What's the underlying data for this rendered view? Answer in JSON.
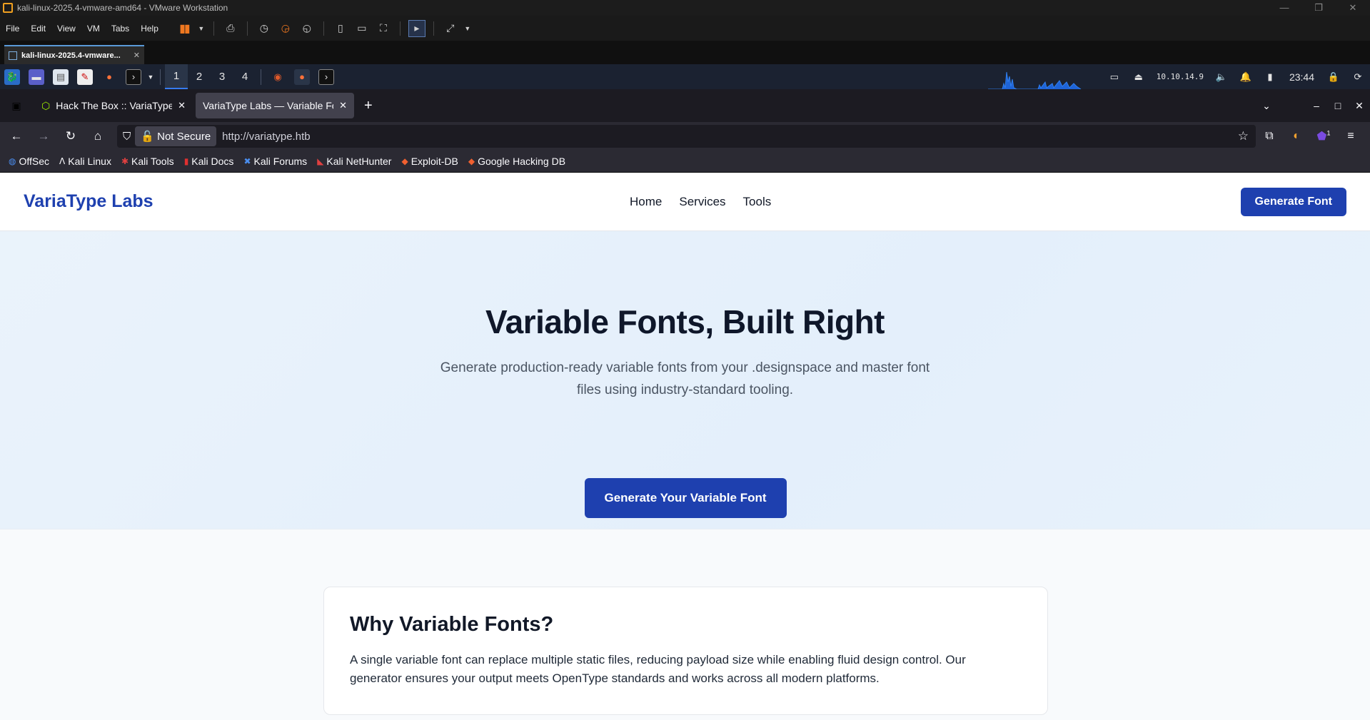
{
  "vmware": {
    "title": "kali-linux-2025.4-vmware-amd64 - VMware Workstation",
    "menu": [
      "File",
      "Edit",
      "View",
      "VM",
      "Tabs",
      "Help"
    ],
    "tab_label": "kali-linux-2025.4-vmware..."
  },
  "kali_panel": {
    "workspaces": [
      "1",
      "2",
      "3",
      "4"
    ],
    "ip": "10.10.14.9",
    "clock": "23:44"
  },
  "browser": {
    "tabs": [
      {
        "title": "Hack The Box :: VariaType"
      },
      {
        "title": "VariaType Labs — Variable Fo"
      }
    ],
    "security_label": "Not Secure",
    "url": "http://variatype.htb",
    "extension_badge": "1",
    "bookmarks": [
      "OffSec",
      "Kali Linux",
      "Kali Tools",
      "Kali Docs",
      "Kali Forums",
      "Kali NetHunter",
      "Exploit-DB",
      "Google Hacking DB"
    ]
  },
  "site": {
    "brand": "VariaType Labs",
    "nav": [
      "Home",
      "Services",
      "Tools"
    ],
    "cta_header": "Generate Font",
    "hero": {
      "title": "Variable Fonts, Built Right",
      "subtitle": "Generate production-ready variable fonts from your .designspace and master font files using industry-standard tooling.",
      "button": "Generate Your Variable Font"
    },
    "card": {
      "title": "Why Variable Fonts?",
      "body": "A single variable font can replace multiple static files, reducing payload size while enabling fluid design control. Our generator ensures your output meets OpenType standards and works across all modern platforms."
    }
  },
  "colors": {
    "brand": "#1e40af",
    "kali_accent": "#367bf0",
    "htb_green": "#9fef00"
  }
}
